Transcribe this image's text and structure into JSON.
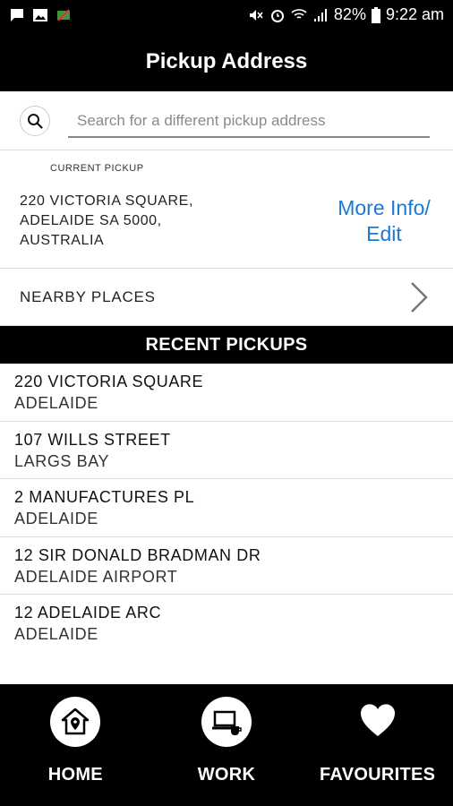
{
  "status_bar": {
    "battery": "82%",
    "time": "9:22 am",
    "icons_left": [
      "message-icon",
      "image-icon",
      "app-notification-icon"
    ],
    "icons_right": [
      "mute-icon",
      "alarm-icon",
      "wifi-icon",
      "signal-icon",
      "battery-icon"
    ]
  },
  "header": {
    "title": "Pickup Address"
  },
  "search": {
    "placeholder": "Search for a different pickup address",
    "icon": "search-icon"
  },
  "current_pickup": {
    "label": "CURRENT PICKUP",
    "address_lines": [
      "220 VICTORIA SQUARE,",
      "ADELAIDE SA 5000,",
      "AUSTRALIA"
    ],
    "more_info_line1": "More Info/",
    "more_info_line2": "Edit"
  },
  "nearby": {
    "label": "NEARBY PLACES",
    "icon": "chevron-right-icon"
  },
  "recent": {
    "header": "RECENT PICKUPS",
    "items": [
      {
        "street": "220 VICTORIA SQUARE",
        "suburb": "ADELAIDE"
      },
      {
        "street": "107 WILLS STREET",
        "suburb": "LARGS BAY"
      },
      {
        "street": "2 MANUFACTURES PL",
        "suburb": "ADELAIDE"
      },
      {
        "street": "12 SIR DONALD BRADMAN DR",
        "suburb": "ADELAIDE AIRPORT"
      },
      {
        "street": "12 ADELAIDE ARC",
        "suburb": "ADELAIDE"
      }
    ]
  },
  "bottom_nav": {
    "items": [
      {
        "label": "HOME",
        "icon": "home-location-icon"
      },
      {
        "label": "WORK",
        "icon": "work-laptop-icon"
      },
      {
        "label": "FAVOURITES",
        "icon": "heart-icon"
      }
    ]
  },
  "colors": {
    "link": "#1c78d6",
    "bar_background": "#000000",
    "bar_text": "#ffffff"
  }
}
